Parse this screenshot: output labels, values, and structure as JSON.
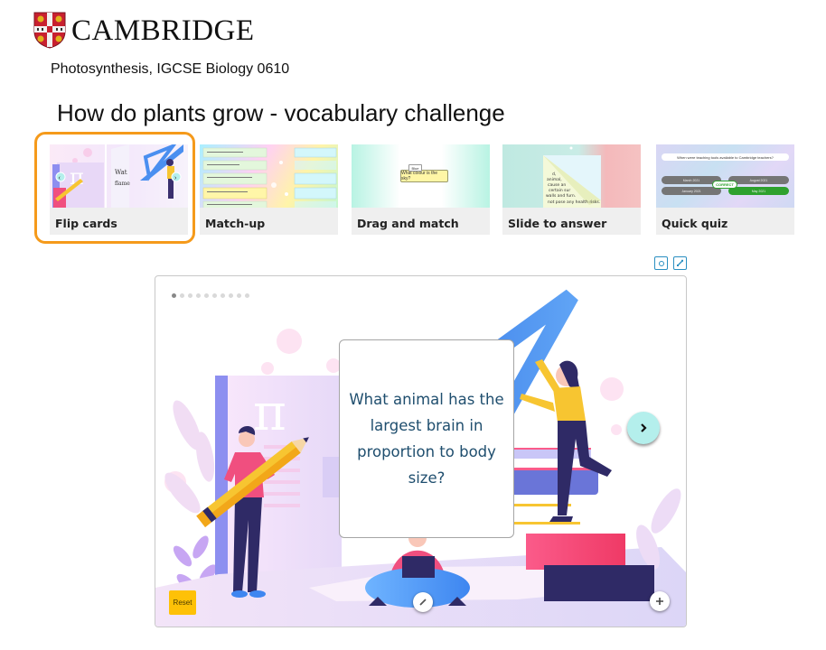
{
  "brand": {
    "name": "CAMBRIDGE",
    "logo_icon": "cambridge-shield-icon"
  },
  "subtitle": "Photosynthesis, IGCSE Biology 0610",
  "title": "How do plants grow - vocabulary challenge",
  "activities": [
    {
      "label": "Flip cards",
      "selected": true
    },
    {
      "label": "Match-up",
      "selected": false
    },
    {
      "label": "Drag and match",
      "selected": false
    },
    {
      "label": "Slide to answer",
      "selected": false
    },
    {
      "label": "Quick quiz",
      "selected": false
    }
  ],
  "thumbnails": {
    "drag": {
      "tag": "Blue",
      "question": "What colour is the sky?"
    },
    "slide": {
      "text": [
        "d,",
        "animal,",
        "cause an",
        "certain sur",
        "walls and furn.",
        "not pose any health risks."
      ]
    },
    "quiz": {
      "question": "When were teaching tools available to Cambridge teachers?",
      "options": [
        "March 2021",
        "August 2021",
        "January 2021",
        "May 2021"
      ],
      "badge": "CORRECT"
    }
  },
  "toolbar": {
    "record_icon": "record-icon",
    "fullscreen_icon": "expand-icon"
  },
  "viewer": {
    "total_cards": 10,
    "current_card": 1,
    "card_question": "What animal has the largest brain in proportion to body size?",
    "next_icon": "chevron-right-icon",
    "edit_icon": "pencil-icon",
    "add_icon": "plus-icon",
    "reset_label": "Reset"
  },
  "colors": {
    "selection_ring": "#f59a1b",
    "card_text": "#1f4e6e",
    "reset_button": "#fec107",
    "next_button": "#b4efec",
    "icon_border": "#2a8fc1"
  }
}
